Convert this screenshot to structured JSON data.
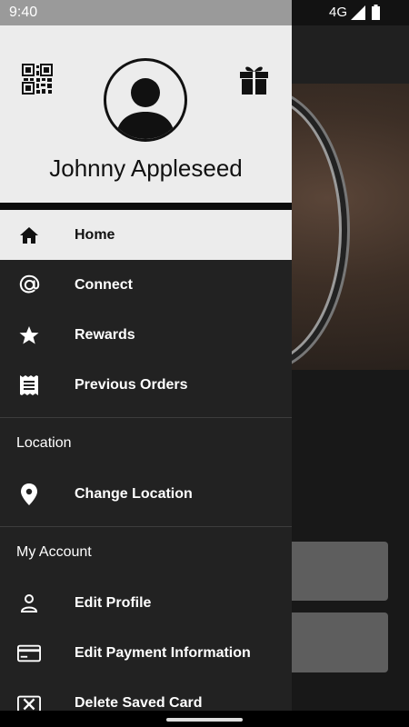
{
  "status_bar": {
    "time": "9:40",
    "network": "4G"
  },
  "drawer": {
    "user_name": "Johnny Appleseed",
    "main_items": [
      {
        "label": "Home",
        "icon": "home-icon",
        "active": true
      },
      {
        "label": "Connect",
        "icon": "at-icon"
      },
      {
        "label": "Rewards",
        "icon": "star-icon"
      },
      {
        "label": "Previous Orders",
        "icon": "receipt-icon"
      }
    ],
    "location_section": {
      "title": "Location",
      "items": [
        {
          "label": "Change Location",
          "icon": "location-pin-icon"
        }
      ]
    },
    "account_section": {
      "title": "My Account",
      "items": [
        {
          "label": "Edit Profile",
          "icon": "person-icon"
        },
        {
          "label": "Edit Payment Information",
          "icon": "credit-card-icon"
        },
        {
          "label": "Delete Saved Card",
          "icon": "delete-card-icon"
        }
      ]
    }
  },
  "colors": {
    "drawer_bg": "#222222",
    "header_bg": "#ececec",
    "active_item_bg": "#ececec"
  }
}
